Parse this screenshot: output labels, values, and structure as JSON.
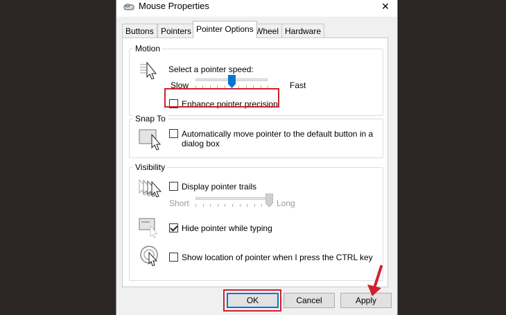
{
  "window": {
    "title": "Mouse Properties",
    "close_symbol": "✕"
  },
  "tabs": [
    {
      "label": "Buttons",
      "active": false
    },
    {
      "label": "Pointers",
      "active": false
    },
    {
      "label": "Pointer Options",
      "active": true
    },
    {
      "label": "Wheel",
      "active": false
    },
    {
      "label": "Hardware",
      "active": false
    }
  ],
  "motion": {
    "legend": "Motion",
    "speed_label": "Select a pointer speed:",
    "slow_label": "Slow",
    "fast_label": "Fast",
    "speed_value": 0.5,
    "precision_label": "Enhance pointer precision",
    "precision_checked": false
  },
  "snap": {
    "legend": "Snap To",
    "label_line1": "Automatically move pointer to the default button in a",
    "label_line2": "dialog box",
    "checked": false
  },
  "visibility": {
    "legend": "Visibility",
    "trails_label": "Display pointer trails",
    "trails_checked": false,
    "short_label": "Short",
    "long_label": "Long",
    "trails_value": 1.0,
    "hide_label": "Hide pointer while typing",
    "hide_checked": true,
    "ctrl_label": "Show location of pointer when I press the CTRL key",
    "ctrl_checked": false
  },
  "buttons": {
    "ok": "OK",
    "cancel": "Cancel",
    "apply": "Apply"
  },
  "colors": {
    "highlight": "#d0202d",
    "slider_thumb": "#0078d7",
    "default_button_border": "#0078d7"
  },
  "icons": {
    "title": "mouse-icon",
    "motion": "pointer-speed-icon",
    "snap": "snap-to-button-icon",
    "trails": "pointer-trails-icon",
    "hide": "hide-pointer-icon",
    "ctrl": "locate-pointer-icon",
    "annotation": "red-arrow-icon"
  }
}
